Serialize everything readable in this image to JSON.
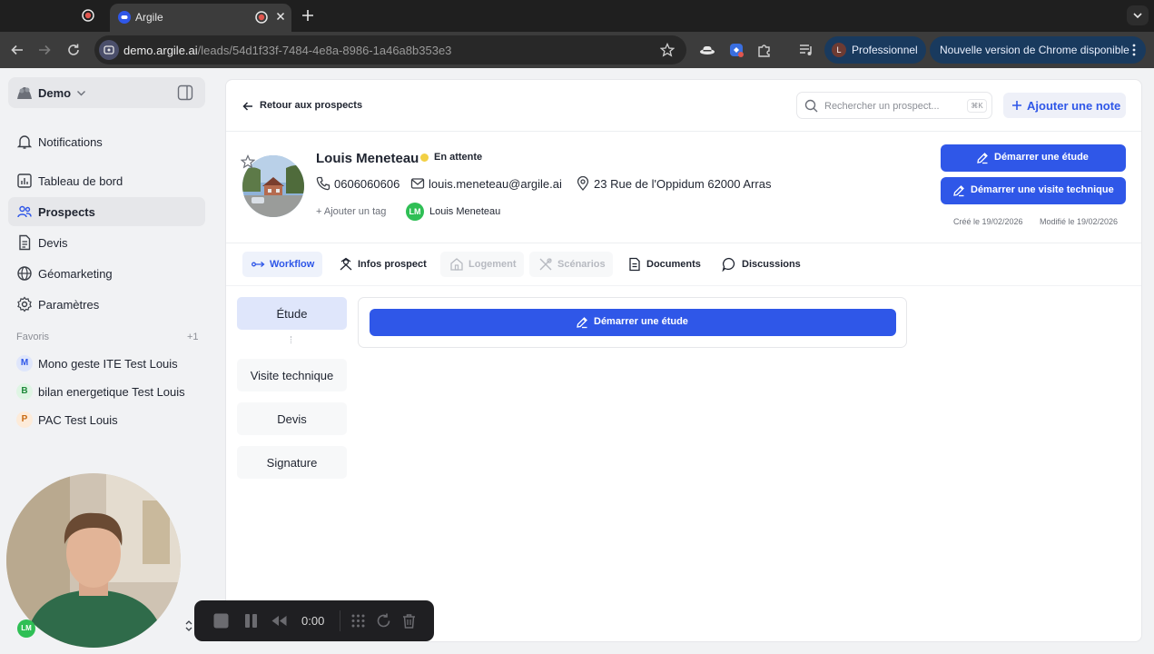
{
  "browser": {
    "tab_title": "Argile",
    "url_host": "demo.argile.ai",
    "url_path": "/leads/54d1f33f-7484-4e8a-8986-1a46a8b353e3",
    "profile_initial": "L",
    "profile_label": "Professionnel",
    "update_label": "Nouvelle version de Chrome disponible"
  },
  "sidebar": {
    "workspace": "Demo",
    "nav": [
      {
        "label": "Notifications",
        "icon": "bell-icon"
      },
      {
        "label": "Tableau de bord",
        "icon": "dashboard-icon"
      },
      {
        "label": "Prospects",
        "icon": "people-icon",
        "active": true
      },
      {
        "label": "Devis",
        "icon": "document-icon"
      },
      {
        "label": "Géomarketing",
        "icon": "globe-icon"
      },
      {
        "label": "Paramètres",
        "icon": "gear-icon"
      }
    ],
    "favorites_title": "Favoris",
    "favorites_count": "+1",
    "favorites": [
      {
        "badge": "M",
        "label": "Mono geste ITE Test Louis",
        "color": "#dfe6fb",
        "text_color": "#2f57e8"
      },
      {
        "badge": "B",
        "label": "bilan energetique Test Louis",
        "color": "#dff5e4",
        "text_color": "#1f8a3b"
      },
      {
        "badge": "P",
        "label": "PAC Test Louis",
        "color": "#fdebd9",
        "text_color": "#c86a12"
      }
    ]
  },
  "header": {
    "back_label": "Retour aux prospects",
    "search_placeholder": "Rechercher un prospect...",
    "search_shortcut": "⌘K",
    "add_note_label": "Ajouter une note"
  },
  "lead": {
    "name": "Louis Meneteau",
    "status": "En attente",
    "status_color": "#f2d044",
    "phone": "0606060606",
    "email": "louis.meneteau@argile.ai",
    "address": "23 Rue de l'Oppidum 62000 Arras",
    "add_tag_label": "+ Ajouter un tag",
    "owner_initials": "LM",
    "owner_name": "Louis Meneteau",
    "created": "Créé le 19/02/2026",
    "modified": "Modifié le 19/02/2026"
  },
  "actions": {
    "start_study": "Démarrer une étude",
    "start_visit": "Démarrer une visite technique"
  },
  "tabs": [
    {
      "label": "Workflow",
      "active": true
    },
    {
      "label": "Infos prospect"
    },
    {
      "label": "Logement",
      "disabled": true
    },
    {
      "label": "Scénarios",
      "disabled": true
    },
    {
      "label": "Documents"
    },
    {
      "label": "Discussions"
    }
  ],
  "workflow": {
    "steps": [
      "Étude",
      "Visite technique",
      "Devis",
      "Signature"
    ],
    "card_button": "Démarrer une étude"
  },
  "recorder": {
    "time": "0:00",
    "presenter_initials": "LM"
  },
  "colors": {
    "accent": "#2f57e8",
    "chrome_bg": "#3c3c3c"
  }
}
